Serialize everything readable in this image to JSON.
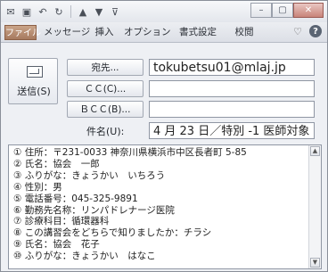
{
  "quick_access": {
    "icons": [
      "outlook-icon",
      "save-icon",
      "undo-icon",
      "redo-icon",
      "up-arrow-icon",
      "down-arrow-icon",
      "customize-icon"
    ]
  },
  "window_controls": {
    "minimize": "–",
    "maximize": "▢",
    "close": "✕"
  },
  "ribbon": {
    "tabs": [
      "ファイル",
      "メッセージ",
      "挿入",
      "オプション",
      "書式設定",
      "校閲"
    ],
    "collapse_glyph": "♡",
    "help_glyph": "?"
  },
  "compose": {
    "send_label": "送信(S)",
    "to_label": "宛先...",
    "cc_label": "ＣＣ(C)...",
    "bcc_label": "ＢＣＣ(B)...",
    "subject_label": "件名(U):",
    "to_value": "tokubetsu01@mlaj.jp",
    "cc_value": "",
    "bcc_value": "",
    "subject_value": "4 月 23 日／特別 -1 医師対象"
  },
  "body": {
    "lines": [
      "① 住所：〒231-0033 神奈川県横浜市中区長者町 5-85",
      "② 氏名：協会　一郎",
      "③ ふりがな：きょうかい　いちろう",
      "④ 性別：男",
      "⑤ 電話番号：045-325-9891",
      "⑥ 勤務先名称：リンパドレナージ医院",
      "⑦ 診療科目：循環器科",
      "⑧ この講習会をどちらで知りましたか：チラシ",
      "⑨ 氏名：協会　花子",
      "⑩ ふりがな：きょうかい　はなこ"
    ]
  },
  "colors": {
    "file_tab": "#a77a5f",
    "window_bg": "#eef0f4",
    "close_button": "#c9847a"
  }
}
